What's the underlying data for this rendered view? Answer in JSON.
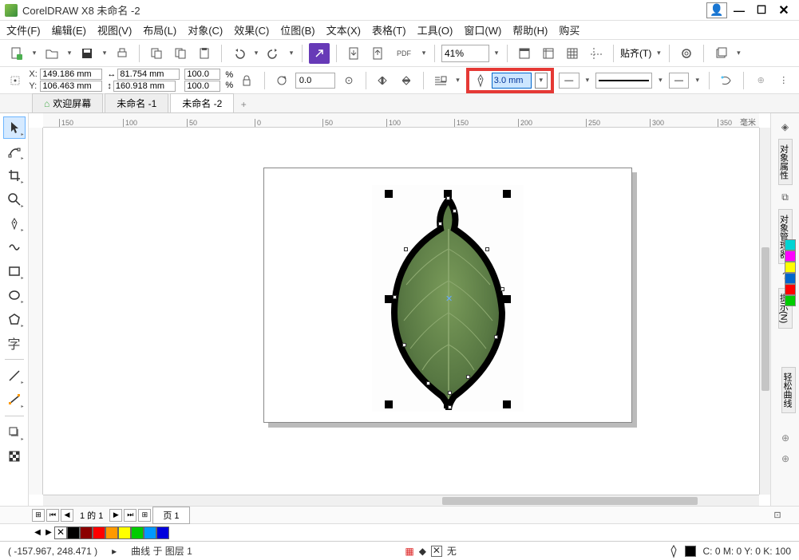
{
  "app": {
    "title": "CorelDRAW X8 未命名 -2"
  },
  "window_buttons": {
    "user": "👤",
    "min": "—",
    "max": "☐",
    "close": "✕"
  },
  "menu": [
    "文件(F)",
    "编辑(E)",
    "视图(V)",
    "布局(L)",
    "对象(C)",
    "效果(C)",
    "位图(B)",
    "文本(X)",
    "表格(T)",
    "工具(O)",
    "窗口(W)",
    "帮助(H)",
    "购买"
  ],
  "toolbar1": {
    "zoom": "41%",
    "pdf_label": "PDF",
    "snap_label": "贴齐(T)"
  },
  "propbar": {
    "x_label": "X:",
    "x_val": "149.186 mm",
    "y_label": "Y:",
    "y_val": "106.463 mm",
    "w_val": "81.754 mm",
    "h_val": "160.918 mm",
    "sx": "100.0",
    "sy": "100.0",
    "pct": "%",
    "rot": "0.0",
    "outline": "3.0 mm",
    "arrow_none": "—"
  },
  "tabs": {
    "welcome": "欢迎屏幕",
    "doc1": "未命名 -1",
    "doc2": "未命名 -2"
  },
  "ruler": {
    "unit": "毫米",
    "ticks": [
      "150",
      "100",
      "50",
      "0",
      "50",
      "100",
      "150",
      "200",
      "250",
      "300",
      "350"
    ]
  },
  "right_dock": {
    "t1": "对象属性",
    "t2": "对象管理器",
    "t3": "提示(N)",
    "t4": "轻松曲线"
  },
  "palette": [
    "#00d4d4",
    "#ff00ff",
    "#ffff00",
    "#0066cc",
    "#ff0000",
    "#00cc00",
    "#ffffff",
    "#dddddd",
    "#999999"
  ],
  "navbar": {
    "page_of": "1 的 1",
    "page_tab": "页 1"
  },
  "colorbar": [
    "#000000",
    "#8b0000",
    "#ff0000",
    "#ff9900",
    "#ffff00",
    "#00cc00",
    "#0099ff",
    "#0000dd"
  ],
  "status": {
    "coords": "( -157.967, 248.471 )",
    "arrow": "▸",
    "object": "曲线 于 图层 1",
    "fill_none": "无",
    "cmyk": "C: 0 M: 0 Y: 0 K: 100"
  }
}
